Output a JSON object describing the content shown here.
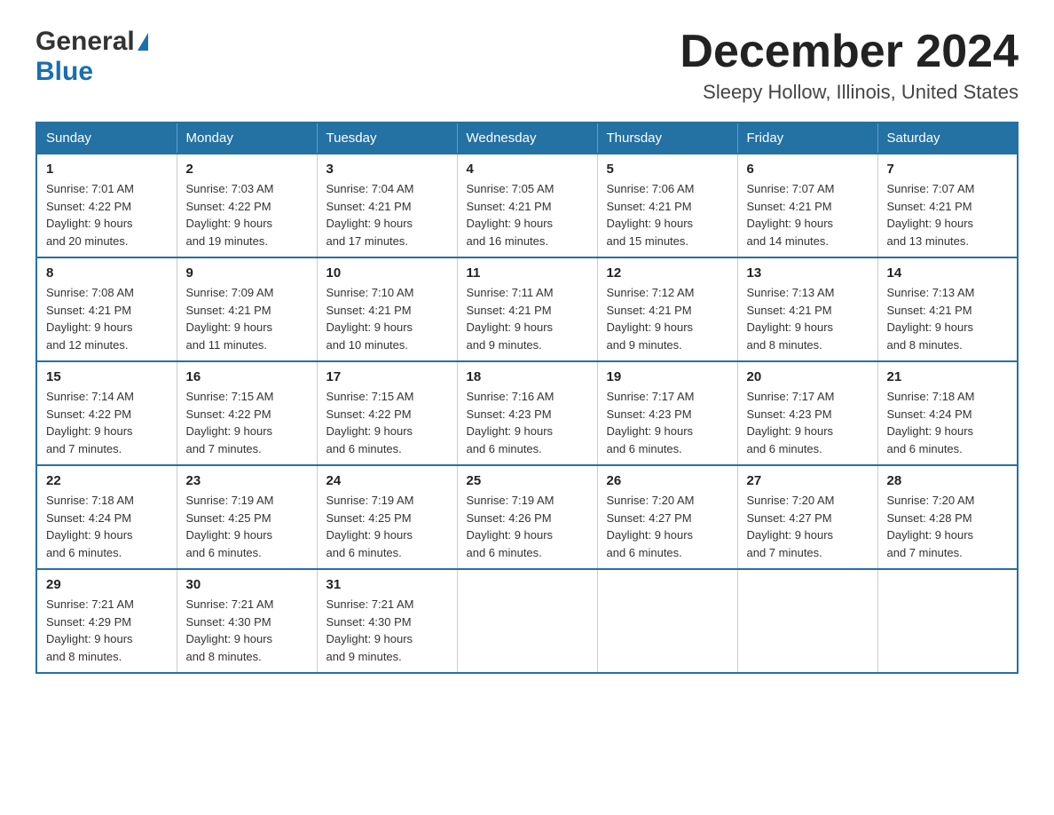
{
  "header": {
    "logo_general": "General",
    "logo_blue": "Blue",
    "month_title": "December 2024",
    "location": "Sleepy Hollow, Illinois, United States"
  },
  "days_of_week": [
    "Sunday",
    "Monday",
    "Tuesday",
    "Wednesday",
    "Thursday",
    "Friday",
    "Saturday"
  ],
  "weeks": [
    [
      {
        "day": "1",
        "sunrise": "7:01 AM",
        "sunset": "4:22 PM",
        "daylight": "9 hours and 20 minutes."
      },
      {
        "day": "2",
        "sunrise": "7:03 AM",
        "sunset": "4:22 PM",
        "daylight": "9 hours and 19 minutes."
      },
      {
        "day": "3",
        "sunrise": "7:04 AM",
        "sunset": "4:21 PM",
        "daylight": "9 hours and 17 minutes."
      },
      {
        "day": "4",
        "sunrise": "7:05 AM",
        "sunset": "4:21 PM",
        "daylight": "9 hours and 16 minutes."
      },
      {
        "day": "5",
        "sunrise": "7:06 AM",
        "sunset": "4:21 PM",
        "daylight": "9 hours and 15 minutes."
      },
      {
        "day": "6",
        "sunrise": "7:07 AM",
        "sunset": "4:21 PM",
        "daylight": "9 hours and 14 minutes."
      },
      {
        "day": "7",
        "sunrise": "7:07 AM",
        "sunset": "4:21 PM",
        "daylight": "9 hours and 13 minutes."
      }
    ],
    [
      {
        "day": "8",
        "sunrise": "7:08 AM",
        "sunset": "4:21 PM",
        "daylight": "9 hours and 12 minutes."
      },
      {
        "day": "9",
        "sunrise": "7:09 AM",
        "sunset": "4:21 PM",
        "daylight": "9 hours and 11 minutes."
      },
      {
        "day": "10",
        "sunrise": "7:10 AM",
        "sunset": "4:21 PM",
        "daylight": "9 hours and 10 minutes."
      },
      {
        "day": "11",
        "sunrise": "7:11 AM",
        "sunset": "4:21 PM",
        "daylight": "9 hours and 9 minutes."
      },
      {
        "day": "12",
        "sunrise": "7:12 AM",
        "sunset": "4:21 PM",
        "daylight": "9 hours and 9 minutes."
      },
      {
        "day": "13",
        "sunrise": "7:13 AM",
        "sunset": "4:21 PM",
        "daylight": "9 hours and 8 minutes."
      },
      {
        "day": "14",
        "sunrise": "7:13 AM",
        "sunset": "4:21 PM",
        "daylight": "9 hours and 8 minutes."
      }
    ],
    [
      {
        "day": "15",
        "sunrise": "7:14 AM",
        "sunset": "4:22 PM",
        "daylight": "9 hours and 7 minutes."
      },
      {
        "day": "16",
        "sunrise": "7:15 AM",
        "sunset": "4:22 PM",
        "daylight": "9 hours and 7 minutes."
      },
      {
        "day": "17",
        "sunrise": "7:15 AM",
        "sunset": "4:22 PM",
        "daylight": "9 hours and 6 minutes."
      },
      {
        "day": "18",
        "sunrise": "7:16 AM",
        "sunset": "4:23 PM",
        "daylight": "9 hours and 6 minutes."
      },
      {
        "day": "19",
        "sunrise": "7:17 AM",
        "sunset": "4:23 PM",
        "daylight": "9 hours and 6 minutes."
      },
      {
        "day": "20",
        "sunrise": "7:17 AM",
        "sunset": "4:23 PM",
        "daylight": "9 hours and 6 minutes."
      },
      {
        "day": "21",
        "sunrise": "7:18 AM",
        "sunset": "4:24 PM",
        "daylight": "9 hours and 6 minutes."
      }
    ],
    [
      {
        "day": "22",
        "sunrise": "7:18 AM",
        "sunset": "4:24 PM",
        "daylight": "9 hours and 6 minutes."
      },
      {
        "day": "23",
        "sunrise": "7:19 AM",
        "sunset": "4:25 PM",
        "daylight": "9 hours and 6 minutes."
      },
      {
        "day": "24",
        "sunrise": "7:19 AM",
        "sunset": "4:25 PM",
        "daylight": "9 hours and 6 minutes."
      },
      {
        "day": "25",
        "sunrise": "7:19 AM",
        "sunset": "4:26 PM",
        "daylight": "9 hours and 6 minutes."
      },
      {
        "day": "26",
        "sunrise": "7:20 AM",
        "sunset": "4:27 PM",
        "daylight": "9 hours and 6 minutes."
      },
      {
        "day": "27",
        "sunrise": "7:20 AM",
        "sunset": "4:27 PM",
        "daylight": "9 hours and 7 minutes."
      },
      {
        "day": "28",
        "sunrise": "7:20 AM",
        "sunset": "4:28 PM",
        "daylight": "9 hours and 7 minutes."
      }
    ],
    [
      {
        "day": "29",
        "sunrise": "7:21 AM",
        "sunset": "4:29 PM",
        "daylight": "9 hours and 8 minutes."
      },
      {
        "day": "30",
        "sunrise": "7:21 AM",
        "sunset": "4:30 PM",
        "daylight": "9 hours and 8 minutes."
      },
      {
        "day": "31",
        "sunrise": "7:21 AM",
        "sunset": "4:30 PM",
        "daylight": "9 hours and 9 minutes."
      },
      null,
      null,
      null,
      null
    ]
  ],
  "labels": {
    "sunrise": "Sunrise:",
    "sunset": "Sunset:",
    "daylight": "Daylight:"
  }
}
